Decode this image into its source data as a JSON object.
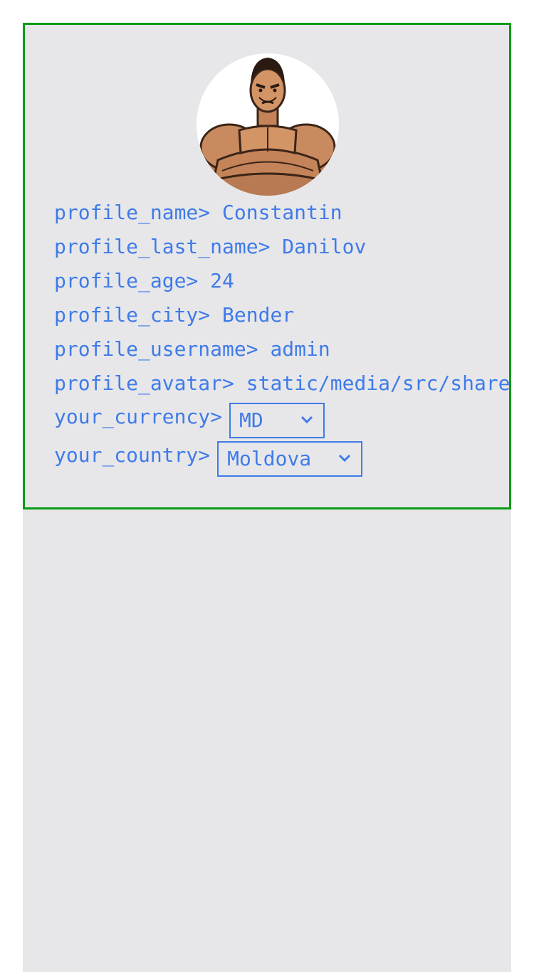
{
  "profile": {
    "avatar_icon": "bodybuilder-avatar",
    "fields": [
      {
        "label": "profile_name>",
        "value": "Constantin"
      },
      {
        "label": "profile_last_name>",
        "value": "Danilov"
      },
      {
        "label": "profile_age>",
        "value": "24"
      },
      {
        "label": "profile_city>",
        "value": "Bender"
      },
      {
        "label": "profile_username>",
        "value": "admin"
      },
      {
        "label": "profile_avatar>",
        "value": "static/media/src/share"
      }
    ],
    "currency": {
      "label": "your_currency>",
      "selected": "MD"
    },
    "country": {
      "label": "your_country>",
      "selected": "Moldova"
    }
  },
  "colors": {
    "accent": "#3f7be8",
    "border": "#0a9a15",
    "panel": "#e7e7ea"
  }
}
